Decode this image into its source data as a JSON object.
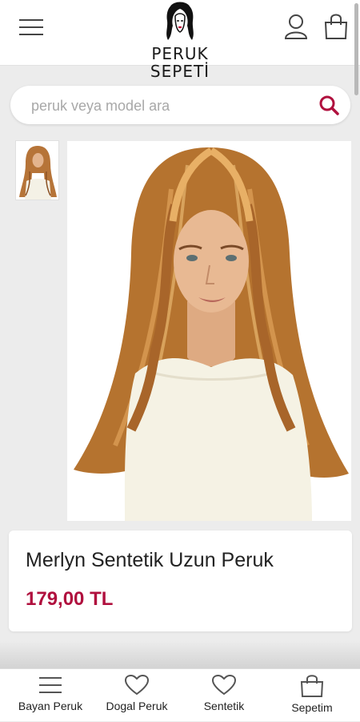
{
  "header": {
    "logo_text": "PERUK SEPETİ"
  },
  "search": {
    "placeholder": "peruk veya model ara"
  },
  "product": {
    "title": "Merlyn Sentetik Uzun Peruk",
    "price": "179,00 TL"
  },
  "bottom_nav": {
    "items": [
      {
        "label": "Bayan Peruk",
        "icon": "menu-icon"
      },
      {
        "label": "Dogal Peruk",
        "icon": "heart-icon"
      },
      {
        "label": "Sentetik",
        "icon": "heart-icon"
      },
      {
        "label": "Sepetim",
        "icon": "bag-icon"
      }
    ]
  },
  "colors": {
    "accent": "#b0103e",
    "background": "#ececec"
  }
}
